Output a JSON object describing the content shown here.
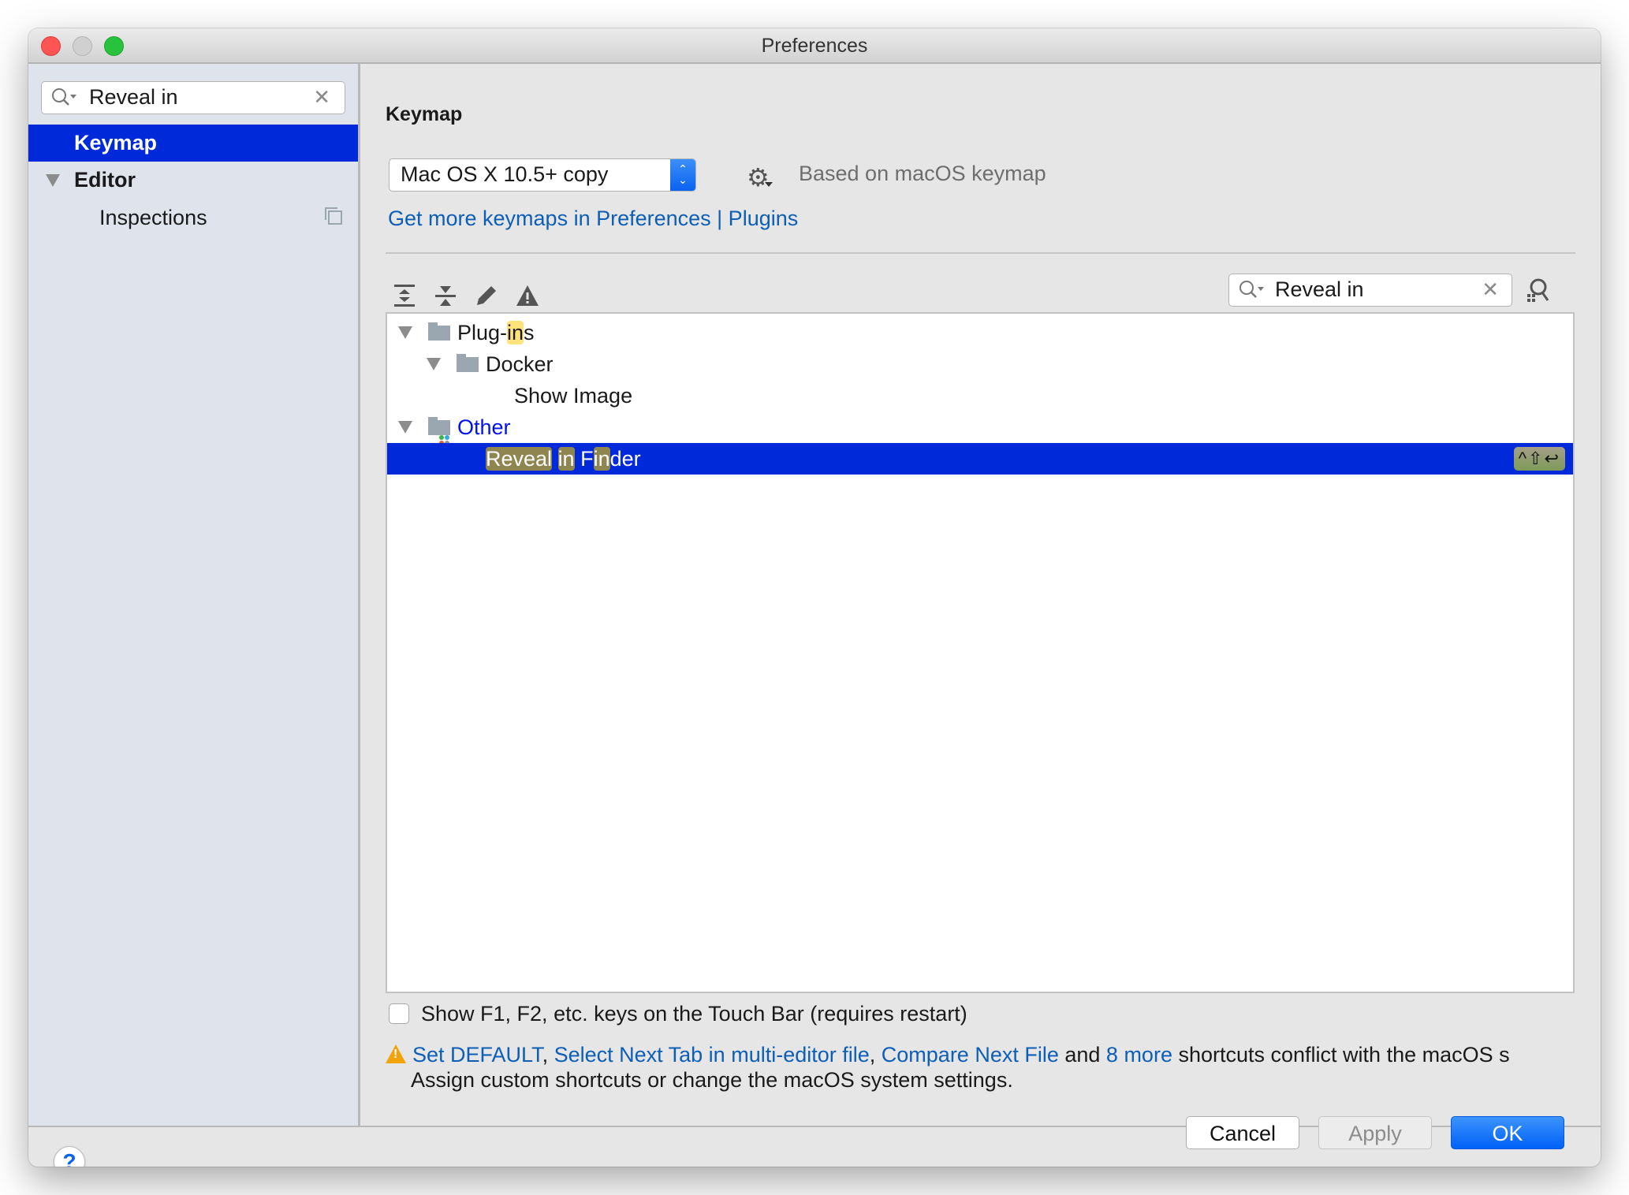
{
  "window": {
    "title": "Preferences"
  },
  "sidebar": {
    "search": {
      "value": "Reveal in",
      "placeholder": ""
    },
    "items": [
      {
        "label": "Keymap",
        "selected": true
      },
      {
        "label": "Editor",
        "expanded": true
      },
      {
        "label": "Inspections"
      }
    ]
  },
  "main": {
    "title": "Keymap",
    "keymap_select": {
      "value": "Mac OS X 10.5+ copy"
    },
    "based_on": "Based on macOS keymap",
    "more_link": "Get more keymaps in Preferences | Plugins",
    "toolbar": {
      "icons": [
        "expand-all-icon",
        "collapse-all-icon",
        "edit-icon",
        "conflicts-warning-icon"
      ]
    },
    "filter": {
      "value": "Reveal in"
    },
    "tree": {
      "rows": [
        {
          "label_pre": "Plug-",
          "label_hl": "in",
          "label_post": "s",
          "type": "folder",
          "level": 0
        },
        {
          "label": "Docker",
          "type": "folder",
          "level": 1
        },
        {
          "label": "Show Image",
          "type": "action",
          "level": 2
        },
        {
          "label": "Other",
          "type": "other-folder",
          "level": 0
        },
        {
          "parts": [
            "Reveal",
            " ",
            "in",
            " F",
            "in",
            "der"
          ],
          "type": "action",
          "level": 2,
          "selected": true,
          "shortcut": "^⇧↩"
        }
      ]
    },
    "touchbar_checkbox": {
      "label": "Show F1, F2, etc. keys on the Touch Bar (requires restart)",
      "checked": false
    },
    "conflict": {
      "links": [
        "Set DEFAULT",
        "Select Next Tab in multi-editor file",
        "Compare Next File",
        "8 more"
      ],
      "sep": ", ",
      "and": " and ",
      "tail": " shortcuts conflict with the macOS s",
      "line2": "Assign custom shortcuts or change the macOS system settings."
    }
  },
  "footer": {
    "help": "?",
    "cancel": "Cancel",
    "apply": "Apply",
    "ok": "OK"
  },
  "colors": {
    "selection": "#0029d9",
    "link": "#0d5eb5",
    "accent": "#0061f7",
    "highlight": "#ffe27a"
  }
}
